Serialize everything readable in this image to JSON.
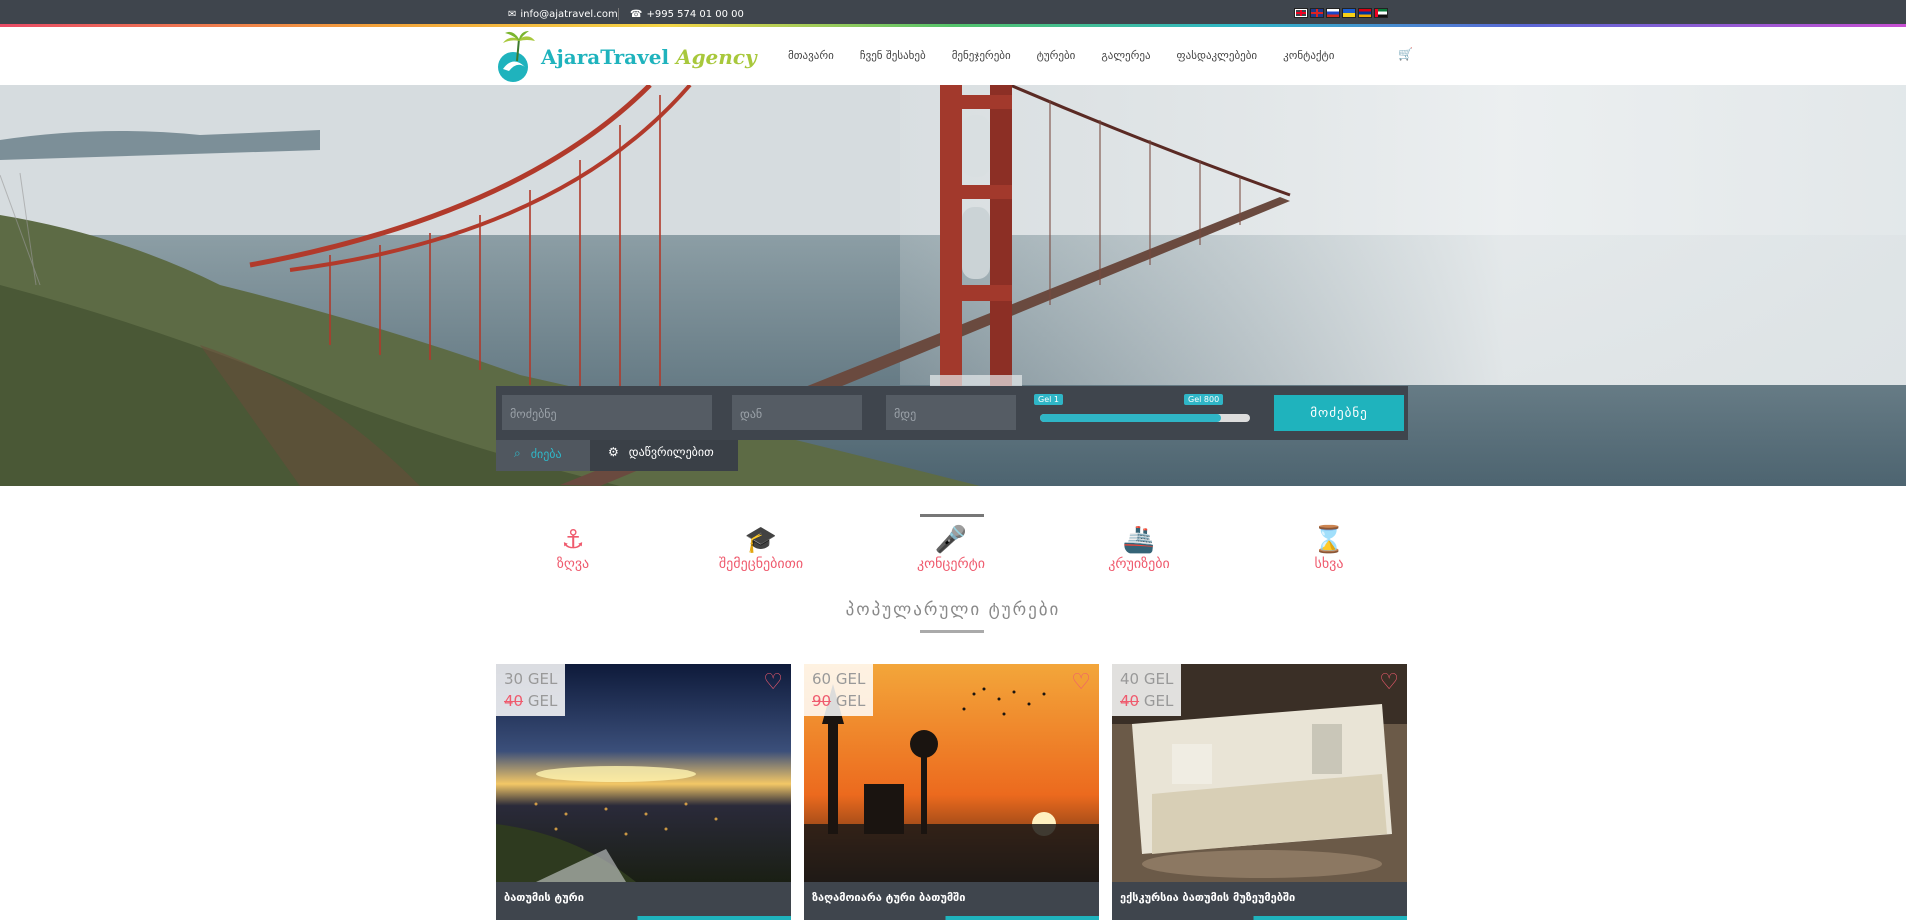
{
  "topbar": {
    "email": "info@ajatravel.com",
    "phone": "+995 574 01 00 00",
    "email_icon": "envelope-icon",
    "phone_icon": "phone-icon",
    "flags": [
      "georgia",
      "uk",
      "russia",
      "ukraine",
      "armenia",
      "uae"
    ]
  },
  "header": {
    "logo_word1": "AjaraTravel",
    "logo_word2": "Agency",
    "nav": [
      "მთავარი",
      "ჩვენ შესახებ",
      "მენეჯერები",
      "ტურები",
      "გალერეა",
      "ფასდაკლებები",
      "კონტაქტი"
    ],
    "cart_icon": "shopping-cart-icon"
  },
  "search": {
    "tab_search": "ძიება",
    "tab_details": "დაწვრილებით",
    "field_keyword": "მოძებნე",
    "field_from": "დან",
    "field_to": "მდე",
    "range_min_label": "Gel 1",
    "range_max_label": "Gel 800",
    "range_fill": 0.86,
    "button": "მოძებნე"
  },
  "categories": [
    {
      "label": "ზღვა",
      "icon": "anchor-icon",
      "glyph": "⚓"
    },
    {
      "label": "შემეცნებითი",
      "icon": "graduation-cap-icon",
      "glyph": "🎓"
    },
    {
      "label": "კონცერტი",
      "icon": "microphone-icon",
      "glyph": "🎤"
    },
    {
      "label": "კრუიზები",
      "icon": "ship-icon",
      "glyph": "🚢"
    },
    {
      "label": "სხვა",
      "icon": "hourglass-icon",
      "glyph": "⌛"
    }
  ],
  "section_title": "პოპულარული ტურები",
  "cards": [
    {
      "price_new": "30 GEL",
      "price_old_num": "40",
      "price_old_unit": " GEL",
      "title": "ბათუმის ტური"
    },
    {
      "price_new": "60 GEL",
      "price_old_num": "90",
      "price_old_unit": " GEL",
      "title": "ზაღამოიარა ტური ბათუმში"
    },
    {
      "price_new": "40 GEL",
      "price_old_num": "40",
      "price_old_unit": " GEL",
      "title": "ექსკურსია ბათუმის მუზეუმებში"
    }
  ],
  "colors": {
    "accent": "#1fb3bd",
    "pink": "#ef5b6e",
    "dark": "#3f454d"
  }
}
